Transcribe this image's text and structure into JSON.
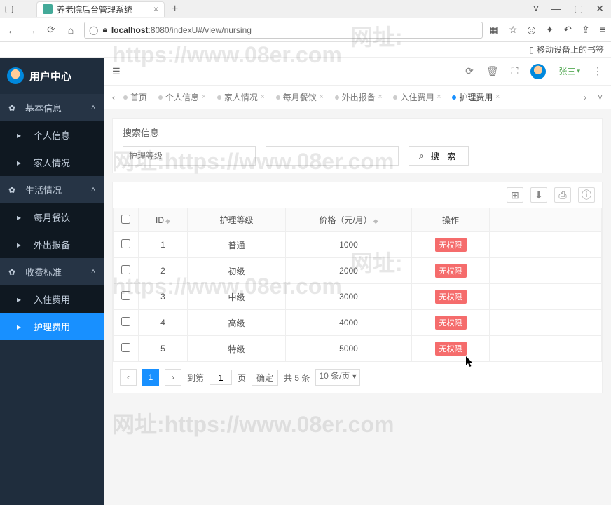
{
  "browser": {
    "tab_title": "养老院后台管理系统",
    "url_host": "localhost",
    "url_port": ":8080",
    "url_path": "/indexU#/view/nursing",
    "bookmark": "移动设备上的书签"
  },
  "sidebar": {
    "title": "用户中心",
    "groups": [
      {
        "label": "基本信息",
        "items": [
          {
            "label": "个人信息"
          },
          {
            "label": "家人情况"
          }
        ]
      },
      {
        "label": "生活情况",
        "items": [
          {
            "label": "每月餐饮"
          },
          {
            "label": "外出报备"
          }
        ]
      },
      {
        "label": "收费标准",
        "items": [
          {
            "label": "入住费用"
          },
          {
            "label": "护理费用",
            "active": true
          }
        ]
      }
    ]
  },
  "topbar": {
    "username": "张三"
  },
  "tabs": {
    "items": [
      {
        "label": "首页",
        "closable": false
      },
      {
        "label": "个人信息",
        "closable": true
      },
      {
        "label": "家人情况",
        "closable": true
      },
      {
        "label": "每月餐饮",
        "closable": true
      },
      {
        "label": "外出报备",
        "closable": true
      },
      {
        "label": "入住费用",
        "closable": true
      },
      {
        "label": "护理费用",
        "closable": true,
        "active": true
      }
    ]
  },
  "search": {
    "title": "搜索信息",
    "placeholder_level": "护理等级",
    "btn_search": "搜 索"
  },
  "table": {
    "headers": {
      "id": "ID",
      "level": "护理等级",
      "price": "价格（元/月）",
      "action": "操作"
    },
    "action_label": "无权限",
    "rows": [
      {
        "id": "1",
        "level": "普通",
        "price": "1000"
      },
      {
        "id": "2",
        "level": "初级",
        "price": "2000"
      },
      {
        "id": "3",
        "level": "中级",
        "price": "3000"
      },
      {
        "id": "4",
        "level": "高级",
        "price": "4000"
      },
      {
        "id": "5",
        "level": "特级",
        "price": "5000"
      }
    ]
  },
  "pagination": {
    "current": "1",
    "goto_label": "到第",
    "page_input": "1",
    "page_suffix": "页",
    "confirm": "确定",
    "total": "共 5 条",
    "per_page": "10 条/页"
  },
  "watermarks": {
    "w1": "网址:",
    "w2": "https://www.08er.com",
    "w3": "网址:https://www.08er.com",
    "w4": "网址:",
    "w5": "https://www.08er.com",
    "w6": "网址:https://www.08er.com"
  }
}
